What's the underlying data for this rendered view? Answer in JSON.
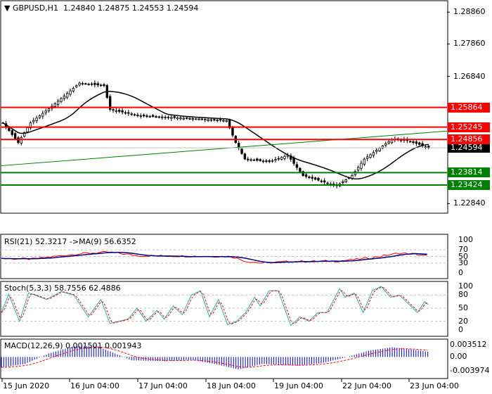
{
  "header": {
    "symbol": "GBPUSD,H1",
    "ohlc": "1.24840 1.24875 1.24553 1.24594"
  },
  "colors": {
    "up": "#000000",
    "red": "#ff0000",
    "green": "#008000",
    "ma": "#000000",
    "trend": "#008000",
    "rsi": "#ff0000",
    "rsi_ma": "#000080",
    "stoch_main": "#20b2aa",
    "stoch_sig": "#ff0000",
    "macd_hist": "#0000ff",
    "macd_sig": "#ff0000"
  },
  "price_axis": {
    "min": 1.2256,
    "max": 1.2922,
    "ticks": [
      "1.28860",
      "1.27860",
      "1.26840",
      "1.22840"
    ]
  },
  "levels": [
    {
      "price": 1.25864,
      "label": "1.25864",
      "color": "#ff0000"
    },
    {
      "price": 1.25245,
      "label": "1.25245",
      "color": "#ff0000"
    },
    {
      "price": 1.24856,
      "label": "1.24856",
      "color": "#ff0000"
    },
    {
      "price": 1.23814,
      "label": "1.23814",
      "color": "#008000"
    },
    {
      "price": 1.23424,
      "label": "1.23424",
      "color": "#008000"
    }
  ],
  "current_price": {
    "price": 1.24594,
    "label": "1.24594"
  },
  "trendline": {
    "from_price": 1.2403,
    "to_price": 1.2512
  },
  "price_keypoints": [
    [
      0,
      1.2538
    ],
    [
      5,
      1.2476
    ],
    [
      9,
      1.2538
    ],
    [
      16,
      1.259
    ],
    [
      25,
      1.2663
    ],
    [
      33,
      1.2655
    ],
    [
      35,
      1.258
    ],
    [
      45,
      1.256
    ],
    [
      55,
      1.2555
    ],
    [
      64,
      1.255
    ],
    [
      73,
      1.2545
    ],
    [
      76,
      1.2476
    ],
    [
      79,
      1.2424
    ],
    [
      87,
      1.2416
    ],
    [
      93,
      1.2436
    ],
    [
      98,
      1.2372
    ],
    [
      109,
      1.234
    ],
    [
      114,
      1.2372
    ],
    [
      118,
      1.2424
    ],
    [
      127,
      1.2486
    ],
    [
      132,
      1.2482
    ],
    [
      136,
      1.247
    ],
    [
      139,
      1.2459
    ]
  ],
  "rsi": {
    "label": "RSI(21) 52.3217  ->MA(9) 56.6352",
    "ticks": [
      "100",
      "70",
      "50",
      "30",
      "0"
    ],
    "keypoints": [
      [
        0,
        44
      ],
      [
        10,
        42
      ],
      [
        25,
        58
      ],
      [
        35,
        63
      ],
      [
        45,
        52
      ],
      [
        75,
        50
      ],
      [
        80,
        35
      ],
      [
        85,
        30
      ],
      [
        95,
        35
      ],
      [
        110,
        36
      ],
      [
        120,
        45
      ],
      [
        130,
        60
      ],
      [
        135,
        57
      ],
      [
        139,
        52
      ]
    ]
  },
  "stoch": {
    "label": "Stoch(5,3,3) 58.7556 62.4886",
    "ticks": [
      "100",
      "80",
      "50",
      "20",
      "0"
    ],
    "keypoints": [
      [
        0,
        40
      ],
      [
        4,
        82
      ],
      [
        10,
        20
      ],
      [
        15,
        85
      ],
      [
        25,
        70
      ],
      [
        33,
        88
      ],
      [
        40,
        80
      ],
      [
        48,
        30
      ],
      [
        55,
        70
      ],
      [
        60,
        15
      ],
      [
        70,
        25
      ],
      [
        75,
        50
      ],
      [
        80,
        20
      ],
      [
        86,
        45
      ],
      [
        90,
        25
      ],
      [
        95,
        55
      ],
      [
        100,
        35
      ],
      [
        105,
        80
      ],
      [
        110,
        90
      ],
      [
        115,
        30
      ],
      [
        120,
        70
      ],
      [
        125,
        12
      ],
      [
        130,
        20
      ],
      [
        135,
        40
      ],
      [
        140,
        75
      ],
      [
        143,
        55
      ],
      [
        148,
        90
      ],
      [
        153,
        90
      ],
      [
        160,
        10
      ],
      [
        165,
        30
      ],
      [
        170,
        20
      ],
      [
        175,
        40
      ],
      [
        180,
        40
      ],
      [
        187,
        95
      ],
      [
        190,
        75
      ],
      [
        195,
        85
      ],
      [
        200,
        40
      ],
      [
        205,
        90
      ],
      [
        210,
        100
      ],
      [
        215,
        75
      ],
      [
        220,
        80
      ],
      [
        225,
        60
      ],
      [
        230,
        40
      ],
      [
        234,
        65
      ],
      [
        236,
        58
      ]
    ]
  },
  "macd": {
    "label": "MACD(12,26,9) 0.001501 0.001943",
    "ticks": [
      "0.003512",
      "0.00",
      "-0.003974"
    ],
    "keypoints": [
      [
        0,
        -0.003
      ],
      [
        10,
        -0.002
      ],
      [
        20,
        0.001
      ],
      [
        30,
        0.003
      ],
      [
        40,
        0.0032
      ],
      [
        48,
        0.001
      ],
      [
        55,
        -0.001
      ],
      [
        70,
        -0.0012
      ],
      [
        80,
        -0.0008
      ],
      [
        90,
        -0.002
      ],
      [
        100,
        -0.0036
      ],
      [
        110,
        -0.002
      ],
      [
        125,
        -0.0025
      ],
      [
        135,
        -0.0018
      ],
      [
        145,
        -0.0002
      ],
      [
        155,
        0.0018
      ],
      [
        165,
        0.0028
      ],
      [
        175,
        0.002
      ],
      [
        180,
        0.0015
      ]
    ]
  },
  "time_axis": [
    "15 Jun 2020",
    "16 Jun 04:00",
    "17 Jun 04:00",
    "18 Jun 04:00",
    "19 Jun 04:00",
    "22 Jun 04:00",
    "23 Jun 04:00"
  ]
}
